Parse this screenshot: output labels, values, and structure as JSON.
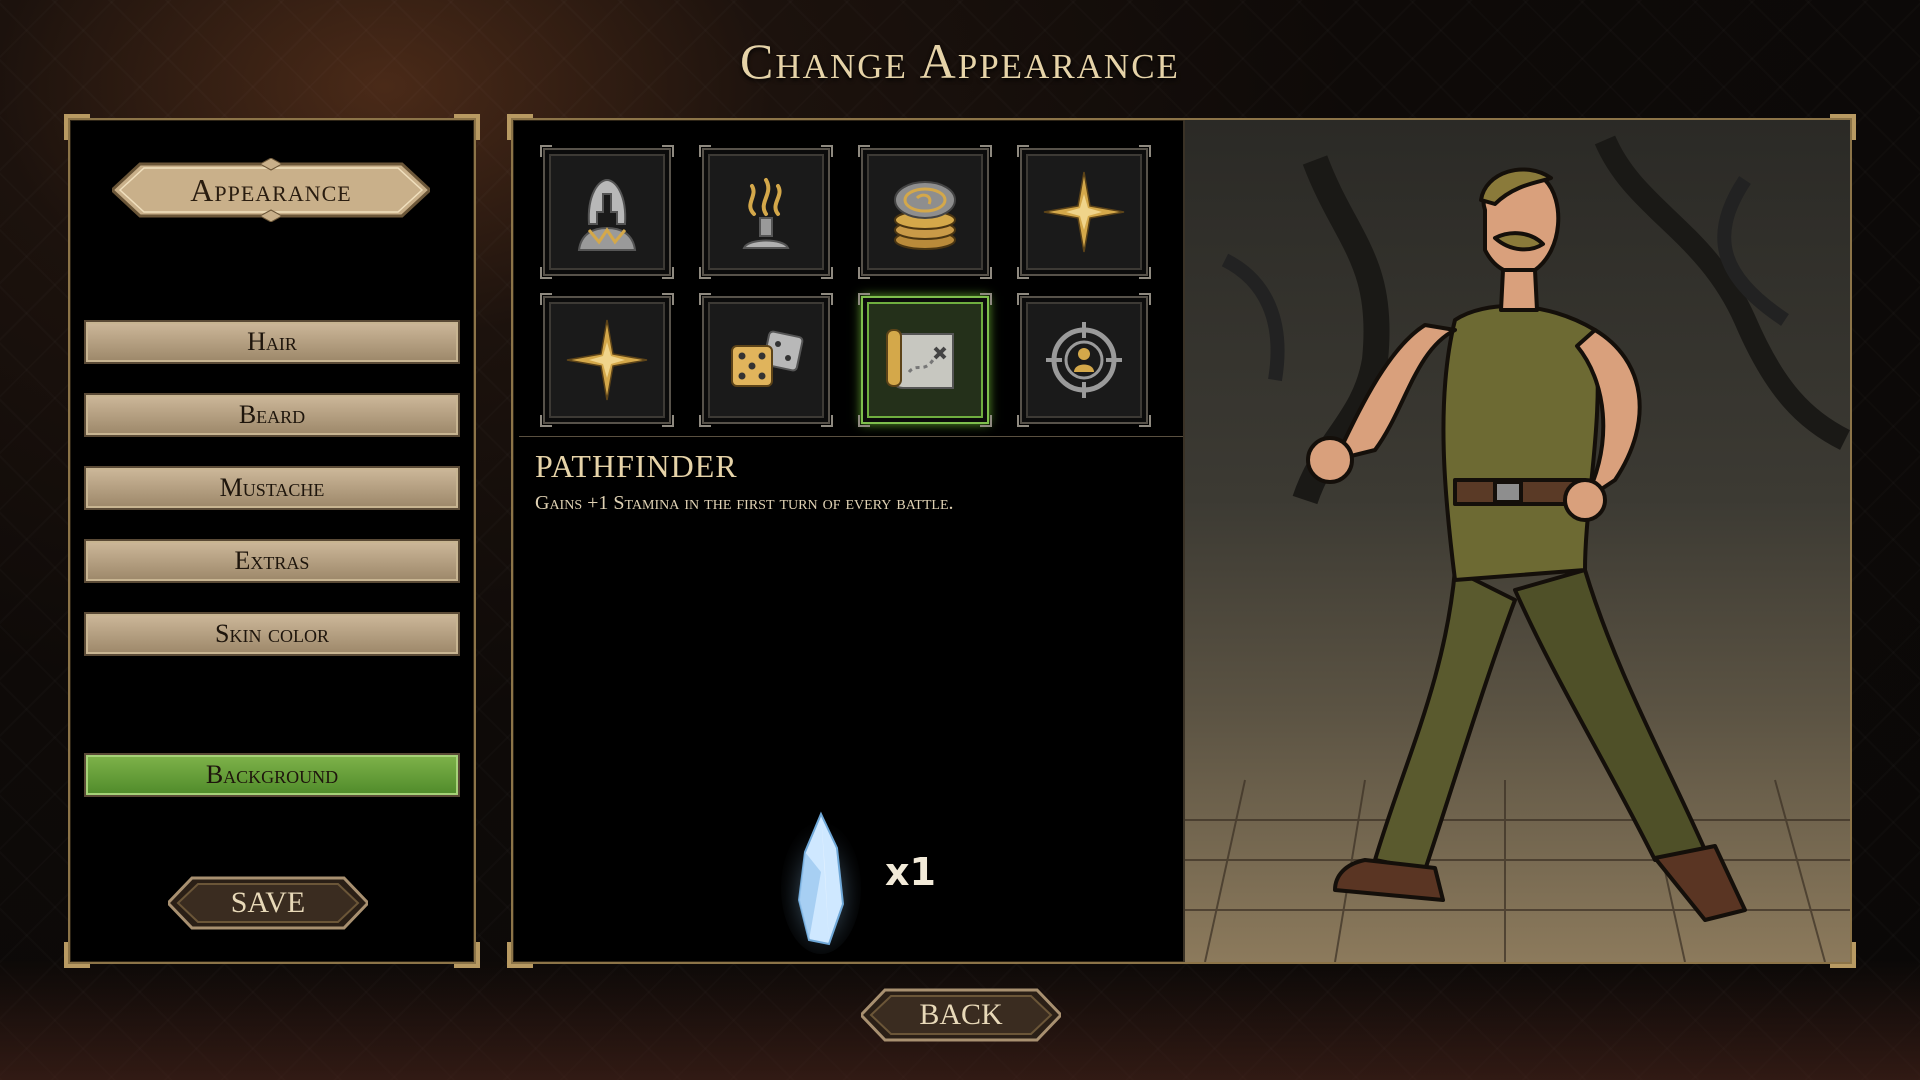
{
  "title": "Change Appearance",
  "left_panel": {
    "banner": "Appearance",
    "menu": [
      {
        "label": "Hair",
        "active": false
      },
      {
        "label": "Beard",
        "active": false
      },
      {
        "label": "Mustache",
        "active": false
      },
      {
        "label": "Extras",
        "active": false
      },
      {
        "label": "Skin color",
        "active": false
      },
      {
        "label": "Background",
        "active": true
      }
    ],
    "save_label": "SAVE"
  },
  "perks": [
    {
      "icon": "helmet-icon",
      "selected": false
    },
    {
      "icon": "smoke-incense-icon",
      "selected": false
    },
    {
      "icon": "coins-icon",
      "selected": false
    },
    {
      "icon": "compass-star-icon",
      "selected": false
    },
    {
      "icon": "compass-star-icon",
      "selected": false
    },
    {
      "icon": "dice-icon",
      "selected": false
    },
    {
      "icon": "treasure-map-icon",
      "selected": true
    },
    {
      "icon": "target-person-icon",
      "selected": false
    }
  ],
  "selected_perk": {
    "name": "PATHFINDER",
    "description": "Gains +1 Stamina in the first turn of every battle."
  },
  "currency": {
    "icon": "crystal-icon",
    "count": "x1"
  },
  "back_label": "BACK",
  "colors": {
    "accent_green": "#6fae3f",
    "frame_gold": "#b89a62"
  }
}
